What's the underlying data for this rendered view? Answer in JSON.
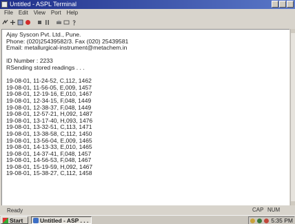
{
  "window": {
    "title": "Untitled - ASPL Terminal"
  },
  "menu": [
    "File",
    "Edit",
    "View",
    "Port",
    "Help"
  ],
  "toolbar": {
    "icons": [
      "connect-icon",
      "disconnect-icon",
      "record-icon",
      "stop-icon",
      "print-icon",
      "help-icon"
    ]
  },
  "content": {
    "header": [
      "Ajay Syscon Pvt. Ltd., Pune.",
      "Phone: (020)25439582/3. Fax (020) 25439581",
      "Email: metallurgical-instrument@metachem.in"
    ],
    "id_line": "ID Number : 2233",
    "status_line": "RSending stored readings . . .",
    "readings": [
      "19-08-01, 11-24-52, C,112, 1462",
      "19-08-01, 11-56-05, E,009, 1457",
      "19-08-01, 12-19-16, E,010, 1467",
      "19-08-01, 12-34-15, F,048, 1449",
      "19-08-01, 12-38-37, F,048, 1449",
      "19-08-01, 12-57-21, H,092, 1487",
      "19-08-01, 13-17-40, H,093, 1476",
      "19-08-01, 13-32-51, C,113, 1471",
      "19-08-01, 13-38-58, C,112, 1450",
      "19-08-01, 13-56-04, E,009, 1465",
      "19-08-01, 14-13-33, E,010, 1465",
      "19-08-01, 14-37-41, F,048, 1457",
      "19-08-01, 14-56-53, F,048, 1467",
      "19-08-01, 15-19-59, H,092, 1467",
      "19-08-01, 15-38-27, C,112, 1458"
    ]
  },
  "status": {
    "ready": "Ready",
    "caps": "CAP",
    "num": "NUM"
  },
  "taskbar": {
    "start": "Start",
    "task": "Untitled - ASP . . .",
    "time": "5:35 PM"
  },
  "colors": {
    "titlebar": "#1f2f8a",
    "chrome": "#d8d4cc",
    "record": "#d22b2b"
  }
}
